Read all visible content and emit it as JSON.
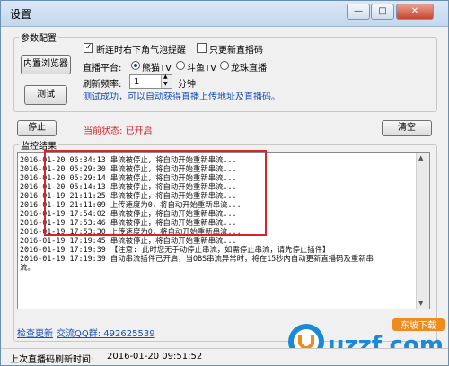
{
  "window": {
    "title": "设置"
  },
  "params": {
    "group_label": "参数配置",
    "browser_button": "内置浏览器",
    "test_button": "测试",
    "disconnect_label": "断连时右下角气泡提醒",
    "disconnect_checked": true,
    "update_only_label": "只更新直播码",
    "update_only_checked": false,
    "platform_label": "直播平台:",
    "platforms": [
      {
        "label": "熊猫TV",
        "selected": true
      },
      {
        "label": "斗鱼TV",
        "selected": false
      },
      {
        "label": "龙珠直播",
        "selected": false
      }
    ],
    "refresh_label": "刷新频率:",
    "refresh_value": "1",
    "refresh_unit": "分钟",
    "test_result": "测试成功，可以自动获得直播上传地址及直播码。"
  },
  "controls": {
    "stop_button": "停止",
    "status_text": "当前状态: 已开启",
    "clear_button": "清空"
  },
  "monitor": {
    "group_label": "监控结果",
    "log": [
      "2016-01-20 06:34:13 串流被停止，将自动开始重新串流...",
      "2016-01-20 05:29:30 串流被停止，将自动开始重新串流...",
      "2016-01-20 05:29:14 串流被停止，将自动开始重新串流...",
      "2016-01-20 05:14:13 串流被停止，将自动开始重新串流...",
      "2016-01-19 21:11:25 串流被停止，将自动开始重新串流...",
      "2016-01-19 21:11:09 上传速度为0，将自动开始重新串流...",
      "2016-01-19 17:54:02 串流被停止，将自动开始重新串流...",
      "2016-01-19 17:53:46 串流被停止，将自动开始重新串流...",
      "2016-01-19 17:53:30 上传速度为0，将自动开始重新串流...",
      "2016-01-19 17:19:45 串流被停止，将自动开始重新串流...",
      "2016-01-19 17:19:39 【注意: 此时您无手动停止串流，如需停止串流，请先停止插件】",
      "2016-01-19 17:19:39 自动串流插件已开启，当OBS串流异常时，将在15秒内自动更新直播码及重新串",
      "流。"
    ]
  },
  "footer": {
    "check_update": "检查更新",
    "qq_group": "交流QQ群: 492625539",
    "last_refresh_label": "上次直播码刷新时间:",
    "last_refresh_time": "2016-01-20 09:51:52"
  },
  "watermark": {
    "brand": "uzzf.com",
    "badge": "东坡下载"
  },
  "colors": {
    "status_red": "#d9232c",
    "link_blue": "#1750b8",
    "highlight": "#d9232c"
  }
}
